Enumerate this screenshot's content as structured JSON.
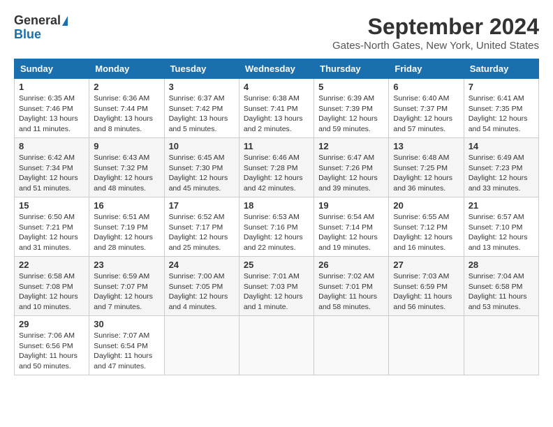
{
  "header": {
    "logo_general": "General",
    "logo_blue": "Blue",
    "title": "September 2024",
    "subtitle": "Gates-North Gates, New York, United States"
  },
  "columns": [
    "Sunday",
    "Monday",
    "Tuesday",
    "Wednesday",
    "Thursday",
    "Friday",
    "Saturday"
  ],
  "weeks": [
    [
      {
        "day": "1",
        "info": "Sunrise: 6:35 AM\nSunset: 7:46 PM\nDaylight: 13 hours\nand 11 minutes."
      },
      {
        "day": "2",
        "info": "Sunrise: 6:36 AM\nSunset: 7:44 PM\nDaylight: 13 hours\nand 8 minutes."
      },
      {
        "day": "3",
        "info": "Sunrise: 6:37 AM\nSunset: 7:42 PM\nDaylight: 13 hours\nand 5 minutes."
      },
      {
        "day": "4",
        "info": "Sunrise: 6:38 AM\nSunset: 7:41 PM\nDaylight: 13 hours\nand 2 minutes."
      },
      {
        "day": "5",
        "info": "Sunrise: 6:39 AM\nSunset: 7:39 PM\nDaylight: 12 hours\nand 59 minutes."
      },
      {
        "day": "6",
        "info": "Sunrise: 6:40 AM\nSunset: 7:37 PM\nDaylight: 12 hours\nand 57 minutes."
      },
      {
        "day": "7",
        "info": "Sunrise: 6:41 AM\nSunset: 7:35 PM\nDaylight: 12 hours\nand 54 minutes."
      }
    ],
    [
      {
        "day": "8",
        "info": "Sunrise: 6:42 AM\nSunset: 7:34 PM\nDaylight: 12 hours\nand 51 minutes."
      },
      {
        "day": "9",
        "info": "Sunrise: 6:43 AM\nSunset: 7:32 PM\nDaylight: 12 hours\nand 48 minutes."
      },
      {
        "day": "10",
        "info": "Sunrise: 6:45 AM\nSunset: 7:30 PM\nDaylight: 12 hours\nand 45 minutes."
      },
      {
        "day": "11",
        "info": "Sunrise: 6:46 AM\nSunset: 7:28 PM\nDaylight: 12 hours\nand 42 minutes."
      },
      {
        "day": "12",
        "info": "Sunrise: 6:47 AM\nSunset: 7:26 PM\nDaylight: 12 hours\nand 39 minutes."
      },
      {
        "day": "13",
        "info": "Sunrise: 6:48 AM\nSunset: 7:25 PM\nDaylight: 12 hours\nand 36 minutes."
      },
      {
        "day": "14",
        "info": "Sunrise: 6:49 AM\nSunset: 7:23 PM\nDaylight: 12 hours\nand 33 minutes."
      }
    ],
    [
      {
        "day": "15",
        "info": "Sunrise: 6:50 AM\nSunset: 7:21 PM\nDaylight: 12 hours\nand 31 minutes."
      },
      {
        "day": "16",
        "info": "Sunrise: 6:51 AM\nSunset: 7:19 PM\nDaylight: 12 hours\nand 28 minutes."
      },
      {
        "day": "17",
        "info": "Sunrise: 6:52 AM\nSunset: 7:17 PM\nDaylight: 12 hours\nand 25 minutes."
      },
      {
        "day": "18",
        "info": "Sunrise: 6:53 AM\nSunset: 7:16 PM\nDaylight: 12 hours\nand 22 minutes."
      },
      {
        "day": "19",
        "info": "Sunrise: 6:54 AM\nSunset: 7:14 PM\nDaylight: 12 hours\nand 19 minutes."
      },
      {
        "day": "20",
        "info": "Sunrise: 6:55 AM\nSunset: 7:12 PM\nDaylight: 12 hours\nand 16 minutes."
      },
      {
        "day": "21",
        "info": "Sunrise: 6:57 AM\nSunset: 7:10 PM\nDaylight: 12 hours\nand 13 minutes."
      }
    ],
    [
      {
        "day": "22",
        "info": "Sunrise: 6:58 AM\nSunset: 7:08 PM\nDaylight: 12 hours\nand 10 minutes."
      },
      {
        "day": "23",
        "info": "Sunrise: 6:59 AM\nSunset: 7:07 PM\nDaylight: 12 hours\nand 7 minutes."
      },
      {
        "day": "24",
        "info": "Sunrise: 7:00 AM\nSunset: 7:05 PM\nDaylight: 12 hours\nand 4 minutes."
      },
      {
        "day": "25",
        "info": "Sunrise: 7:01 AM\nSunset: 7:03 PM\nDaylight: 12 hours\nand 1 minute."
      },
      {
        "day": "26",
        "info": "Sunrise: 7:02 AM\nSunset: 7:01 PM\nDaylight: 11 hours\nand 58 minutes."
      },
      {
        "day": "27",
        "info": "Sunrise: 7:03 AM\nSunset: 6:59 PM\nDaylight: 11 hours\nand 56 minutes."
      },
      {
        "day": "28",
        "info": "Sunrise: 7:04 AM\nSunset: 6:58 PM\nDaylight: 11 hours\nand 53 minutes."
      }
    ],
    [
      {
        "day": "29",
        "info": "Sunrise: 7:06 AM\nSunset: 6:56 PM\nDaylight: 11 hours\nand 50 minutes."
      },
      {
        "day": "30",
        "info": "Sunrise: 7:07 AM\nSunset: 6:54 PM\nDaylight: 11 hours\nand 47 minutes."
      },
      null,
      null,
      null,
      null,
      null
    ]
  ]
}
